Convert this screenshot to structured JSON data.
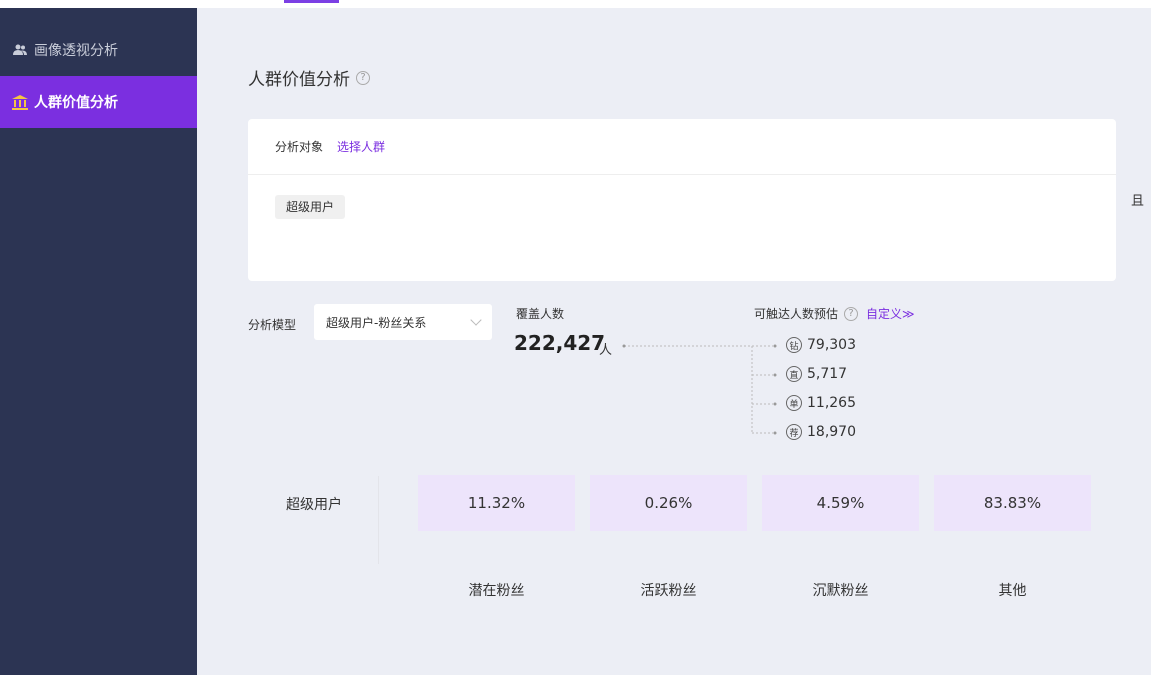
{
  "sidebar": {
    "items": [
      {
        "label": "画像透视分析",
        "icon": "users-icon",
        "active": false
      },
      {
        "label": "人群价值分析",
        "icon": "bank-icon",
        "active": true
      }
    ]
  },
  "main": {
    "title": "人群价值分析",
    "help": "?",
    "object_card": {
      "label": "分析对象",
      "select_link": "选择人群",
      "selected_tag": "超级用户"
    },
    "edge_char": "且",
    "model": {
      "label": "分析模型",
      "selected": "超级用户-粉丝关系"
    },
    "cover": {
      "label": "覆盖人数",
      "value": "222,427",
      "unit": "人"
    },
    "reach": {
      "label": "可触达人数预估",
      "custom_link": "自定义≫",
      "rows": [
        {
          "badge": "钻",
          "value": "79,303"
        },
        {
          "badge": "直",
          "value": "5,717"
        },
        {
          "badge": "单",
          "value": "11,265"
        },
        {
          "badge": "荐",
          "value": "18,970"
        }
      ]
    },
    "matrix": {
      "row_label": "超级用户",
      "cells": [
        "11.32%",
        "0.26%",
        "4.59%",
        "83.83%"
      ],
      "columns": [
        "潜在粉丝",
        "活跃粉丝",
        "沉默粉丝",
        "其他"
      ]
    }
  },
  "colors": {
    "accent": "#7b2fe0",
    "sidebar_bg": "#2c3453",
    "cell_bg": "#ede4fb"
  }
}
